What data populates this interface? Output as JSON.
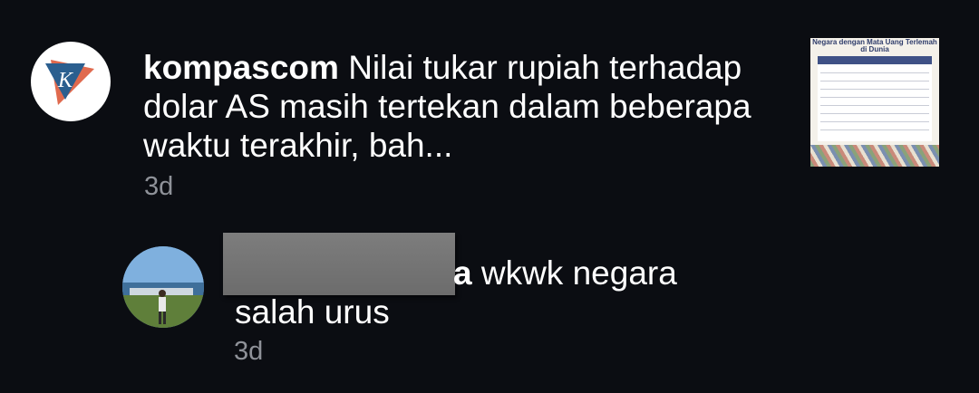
{
  "comments": [
    {
      "username": "kompascom",
      "text": "Nilai tukar rupiah terhadap dolar AS masih tertekan dalam beberapa waktu terakhir, bah...",
      "time": "3d",
      "avatar_icon": "kompas-logo-icon",
      "thumbnail": {
        "title": "Negara dengan Mata Uang Terlemah di Dunia"
      }
    },
    {
      "username_visible_fragment": "a",
      "text_line1": "wkwk negara",
      "text_line2": "salah urus",
      "time": "3d",
      "avatar_icon": "user-avatar-photo"
    }
  ],
  "colors": {
    "background": "#0b0d12",
    "text": "#ffffff",
    "secondary_text": "#8f9299",
    "kompas_blue": "#2b5f8f",
    "kompas_orange": "#e06a4e",
    "redaction": "#747474"
  }
}
